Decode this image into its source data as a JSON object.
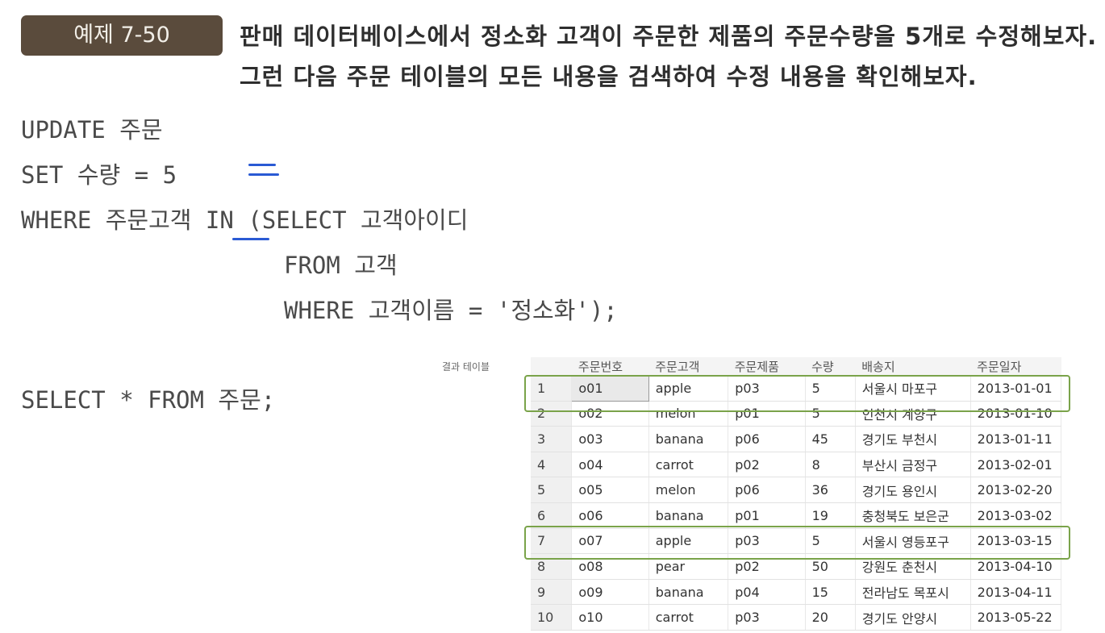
{
  "badge": "예제 7-50",
  "problem": {
    "line1": "판매 데이터베이스에서 정소화 고객이 주문한 제품의 주문수량을 5개로 수정해보자.",
    "line2": "그런 다음 주문 테이블의 모든 내용을 검색하여 수정 내용을 확인해보자."
  },
  "code": {
    "l1": "UPDATE  주문",
    "l2": "SET     수량 = 5",
    "l3": "WHERE   주문고객 IN (SELECT  고객아이디",
    "l4": "FROM    고객",
    "l5": "WHERE   고객이름 = '정소화');",
    "select": "SELECT * FROM 주문;"
  },
  "result": {
    "caption": "결과 테이블",
    "headers": [
      "",
      "주문번호",
      "주문고객",
      "주문제품",
      "수량",
      "배송지",
      "주문일자"
    ],
    "rows": [
      [
        "1",
        "o01",
        "apple",
        "p03",
        "5",
        "서울시 마포구",
        "2013-01-01"
      ],
      [
        "2",
        "o02",
        "melon",
        "p01",
        "5",
        "인천시 계양구",
        "2013-01-10"
      ],
      [
        "3",
        "o03",
        "banana",
        "p06",
        "45",
        "경기도 부천시",
        "2013-01-11"
      ],
      [
        "4",
        "o04",
        "carrot",
        "p02",
        "8",
        "부산시 금정구",
        "2013-02-01"
      ],
      [
        "5",
        "o05",
        "melon",
        "p06",
        "36",
        "경기도 용인시",
        "2013-02-20"
      ],
      [
        "6",
        "o06",
        "banana",
        "p01",
        "19",
        "충청북도 보은군",
        "2013-03-02"
      ],
      [
        "7",
        "o07",
        "apple",
        "p03",
        "5",
        "서울시 영등포구",
        "2013-03-15"
      ],
      [
        "8",
        "o08",
        "pear",
        "p02",
        "50",
        "강원도 춘천시",
        "2013-04-10"
      ],
      [
        "9",
        "o09",
        "banana",
        "p04",
        "15",
        "전라남도 목포시",
        "2013-04-11"
      ],
      [
        "10",
        "o10",
        "carrot",
        "p03",
        "20",
        "경기도 안양시",
        "2013-05-22"
      ]
    ]
  },
  "colors": {
    "badge": "#5a4b3c",
    "highlight": "#7aa34a",
    "pen": "#2a5ad4"
  }
}
